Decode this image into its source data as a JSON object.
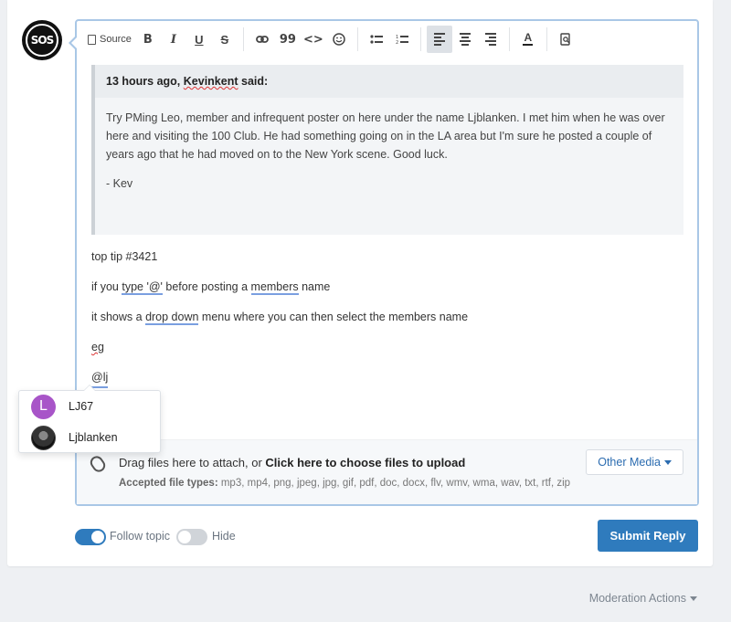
{
  "site": {
    "logo_text": "SOS"
  },
  "toolbar": {
    "source_label": "Source",
    "bold": "B",
    "italic": "I",
    "underline": "U",
    "strike": "S",
    "quote": "99",
    "code": "<>",
    "color": "A",
    "icons": [
      "source-icon",
      "bold-icon",
      "italic-icon",
      "underline-icon",
      "strikethrough-icon",
      "link-icon",
      "quote-icon",
      "code-icon",
      "emoji-icon",
      "bulleted-list-icon",
      "numbered-list-icon",
      "align-left-icon",
      "align-center-icon",
      "align-right-icon",
      "text-color-icon",
      "preview-icon"
    ],
    "active_item": "align-left"
  },
  "quote": {
    "time": "13 hours ago,",
    "user": "Kevinkent",
    "said": "said:",
    "body1": "Try PMing Leo, member and infrequent poster on here under the name Ljblanken. I met him when he was over here and visiting the 100 Club. He had something going on in the LA area but I'm sure he posted a couple of years ago that he had moved on to the New York scene. Good luck.",
    "body2": "- Kev"
  },
  "content": {
    "line1": "top tip #3421",
    "line2_a": "if you ",
    "line2_b": "type  '@'",
    "line2_c": " before posting a ",
    "line2_d": "members",
    "line2_e": " name",
    "line3_a": "it shows a ",
    "line3_b": "drop down",
    "line3_c": " menu where you can then select the members name",
    "line4": "eg",
    "line5": "@lj"
  },
  "mention": {
    "items": [
      {
        "initial": "L",
        "name": "LJ67",
        "color": "#a855c8"
      },
      {
        "name": "Ljblanken"
      }
    ]
  },
  "attach": {
    "drag_text": "Drag files here to attach, or ",
    "choose_text": "Click here to choose files to upload",
    "types_label": "Accepted file types:",
    "types": " mp3, mp4, png, jpeg, jpg, gif, pdf, doc, docx, flv, wmv, wma, wav, txt, rtf, zip",
    "other_media": "Other Media"
  },
  "footer": {
    "follow_label": "Follow topic",
    "follow_on": true,
    "hide_label": "Hide",
    "hide_on": false,
    "submit_label": "Submit Reply",
    "moderation": "Moderation Actions"
  },
  "colors": {
    "accent": "#2f7bbd",
    "editor_border": "#a9c7e6",
    "mention_avatar": "#a855c8"
  }
}
